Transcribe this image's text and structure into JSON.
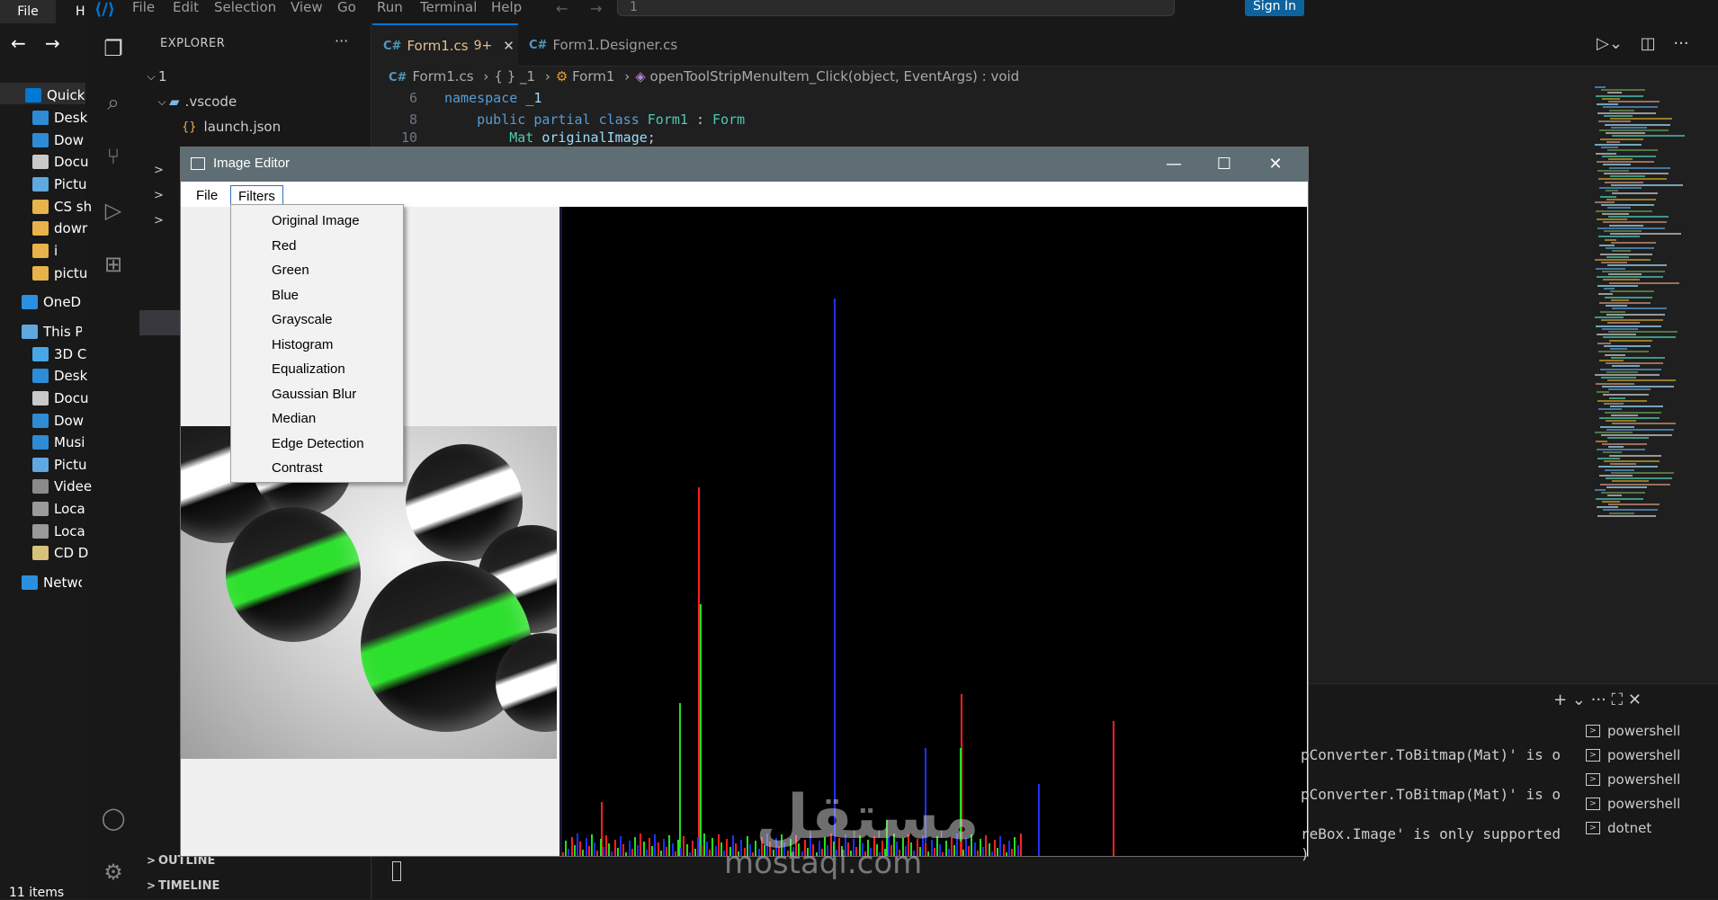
{
  "win_explorer": {
    "file_tab": "File",
    "h_tab": "H",
    "nav_back": "←",
    "nav_forward": "→",
    "items": [
      {
        "label": "Quick",
        "color": "#0078d4"
      },
      {
        "label": "Desk",
        "color": "#2e8bd6"
      },
      {
        "label": "Dow",
        "color": "#2e8bd6"
      },
      {
        "label": "Docu",
        "color": "#c9c9c9"
      },
      {
        "label": "Pictu",
        "color": "#5fa8e0"
      },
      {
        "label": "CS sh",
        "color": "#e8b34a"
      },
      {
        "label": "dowr",
        "color": "#e8b34a"
      },
      {
        "label": "i",
        "color": "#e8b34a"
      },
      {
        "label": "pictu",
        "color": "#e8b34a"
      },
      {
        "label": "OneDr",
        "color": "#2b8fe0"
      },
      {
        "label": "This PC",
        "color": "#5fa8e0"
      },
      {
        "label": "3D C",
        "color": "#47a6e6"
      },
      {
        "label": "Desk",
        "color": "#2e8bd6"
      },
      {
        "label": "Docu",
        "color": "#c9c9c9"
      },
      {
        "label": "Dow",
        "color": "#2e8bd6"
      },
      {
        "label": "Musi",
        "color": "#2e8bd6"
      },
      {
        "label": "Pictu",
        "color": "#5fa8e0"
      },
      {
        "label": "Videe",
        "color": "#8a8a8a"
      },
      {
        "label": "Loca",
        "color": "#9a9a9a"
      },
      {
        "label": "Loca",
        "color": "#9a9a9a"
      },
      {
        "label": "CD D",
        "color": "#d6c27a"
      },
      {
        "label": "Netwo",
        "color": "#2b8fe0"
      }
    ],
    "status": "11 items"
  },
  "vscode": {
    "menu": [
      "File",
      "Edit",
      "Selection",
      "View",
      "Go",
      "Run",
      "Terminal",
      "Help"
    ],
    "command_center_text": "1",
    "signin": "Sign In",
    "explorer_title": "EXPLORER",
    "explorer_more": "···",
    "tree": {
      "root": "1",
      "vscode_folder": ".vscode",
      "launch_file": "launch.json"
    },
    "outline": "OUTLINE",
    "timeline": "TIMELINE",
    "tabs": [
      {
        "label": "Form1.cs",
        "badge": "9+",
        "close": "✕",
        "icon": "C#"
      },
      {
        "label": "Form1.Designer.cs",
        "icon": "C#"
      }
    ],
    "breadcrumb": {
      "file": "Form1.cs",
      "namespace": "{ } _1",
      "class": "Form1",
      "method": "openToolStripMenuItem_Click(object, EventArgs) : void"
    },
    "code_lines": [
      {
        "n": "6",
        "parts": [
          [
            "kw",
            "namespace"
          ],
          [
            "plain",
            " "
          ],
          [
            "var",
            "_1"
          ]
        ]
      },
      {
        "n": "8",
        "parts": [
          [
            "plain",
            "    "
          ],
          [
            "kw",
            "public partial class"
          ],
          [
            "plain",
            " "
          ],
          [
            "cls",
            "Form1"
          ],
          [
            "plain",
            " : "
          ],
          [
            "cls",
            "Form"
          ]
        ]
      },
      {
        "n": "10",
        "parts": [
          [
            "plain",
            "        "
          ],
          [
            "cls",
            "Mat"
          ],
          [
            "plain",
            " "
          ],
          [
            "var",
            "originalImage"
          ],
          [
            "plain",
            ";"
          ]
        ]
      }
    ],
    "terminal_lines": [
      "pConverter.ToBitmap(Mat)' is o",
      "pConverter.ToBitmap(Mat)' is o",
      "reBox.Image' is only supported",
      ")"
    ],
    "terminal_list": [
      "powershell",
      "powershell",
      "powershell",
      "powershell",
      "dotnet"
    ],
    "terminal_actions": "+ ⌄  ···  ⛶  ✕"
  },
  "image_editor": {
    "title": "Image Editor",
    "minimize": "—",
    "maximize": "☐",
    "close": "✕",
    "menu_file": "File",
    "menu_filters": "Filters",
    "filters": [
      "Original Image",
      "Red",
      "Green",
      "Blue",
      "Grayscale",
      "Histogram",
      "Equalization",
      "Gaussian Blur",
      "Median",
      "Edge Detection",
      "Contrast"
    ]
  },
  "colors": {
    "accent": "#0078d4",
    "histogram_red": "#ff2020",
    "histogram_green": "#20e020",
    "histogram_blue": "#2030ff"
  },
  "watermark": {
    "arabic": "مستقل",
    "latin": "mostaql.com"
  }
}
